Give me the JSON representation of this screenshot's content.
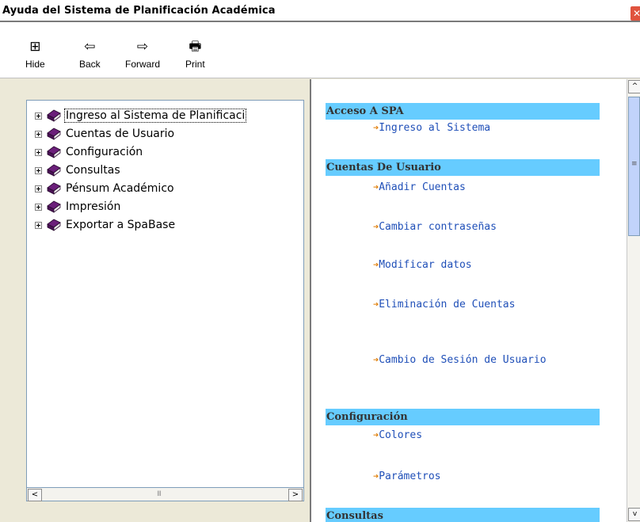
{
  "window": {
    "title": "Ayuda del Sistema de Planificación Académica",
    "close_glyph": "✕"
  },
  "toolbar": [
    {
      "label": "Hide",
      "icon": "hide-icon",
      "glyph": "⊞"
    },
    {
      "label": "Back",
      "icon": "back-arrow-icon",
      "glyph": "⇦"
    },
    {
      "label": "Forward",
      "icon": "forward-arrow-icon",
      "glyph": "⇨"
    },
    {
      "label": "Print",
      "icon": "printer-icon",
      "glyph": "🖶"
    }
  ],
  "tree": [
    {
      "label": "Ingreso al Sistema de Planificaci",
      "selected": true
    },
    {
      "label": "Cuentas de Usuario"
    },
    {
      "label": "Configuración"
    },
    {
      "label": "Consultas"
    },
    {
      "label": "Pénsum Académico"
    },
    {
      "label": "Impresión"
    },
    {
      "label": "Exportar a SpaBase"
    }
  ],
  "scroll": {
    "left_arrow": "<",
    "right_arrow": ">",
    "grip": "III",
    "up_arrow": "^",
    "down_arrow": "v"
  },
  "content": {
    "bullet": "➔",
    "sections": [
      {
        "title": "Acceso A SPA",
        "links": [
          "Ingreso al Sistema"
        ]
      },
      {
        "title": "Cuentas De Usuario",
        "links": [
          "Añadir Cuentas",
          "Cambiar contraseñas",
          "Modificar datos",
          "Eliminación de Cuentas",
          "Cambio de Sesión de Usuario"
        ]
      },
      {
        "title": "Configuración",
        "links": [
          "Colores",
          "Parámetros"
        ]
      },
      {
        "title": "Consultas",
        "links": []
      }
    ]
  },
  "colors": {
    "section_bg": "#66ccff",
    "link": "#1f4fb8",
    "bullet": "#e07b00",
    "book": "#6b1f7a"
  }
}
